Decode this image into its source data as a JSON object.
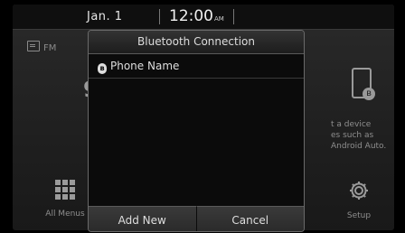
{
  "status_bar": {
    "date": "Jan.  1",
    "time": "12:00",
    "ampm": "AM"
  },
  "background": {
    "radio": {
      "band": "FM",
      "frequency": "9"
    },
    "phone_projection_hint": {
      "lines": [
        "t a device",
        "es such as",
        "Android Auto."
      ]
    },
    "all_menus_label": "All Menus",
    "setup_label": "Setup"
  },
  "dialog": {
    "title": "Bluetooth Connection",
    "devices": [
      {
        "name": "Phone Name"
      }
    ],
    "buttons": {
      "add_new": "Add New",
      "cancel": "Cancel"
    }
  },
  "icons": [
    "radio-icon",
    "phone-icon",
    "bluetooth-icon",
    "grid-icon",
    "gear-icon"
  ]
}
